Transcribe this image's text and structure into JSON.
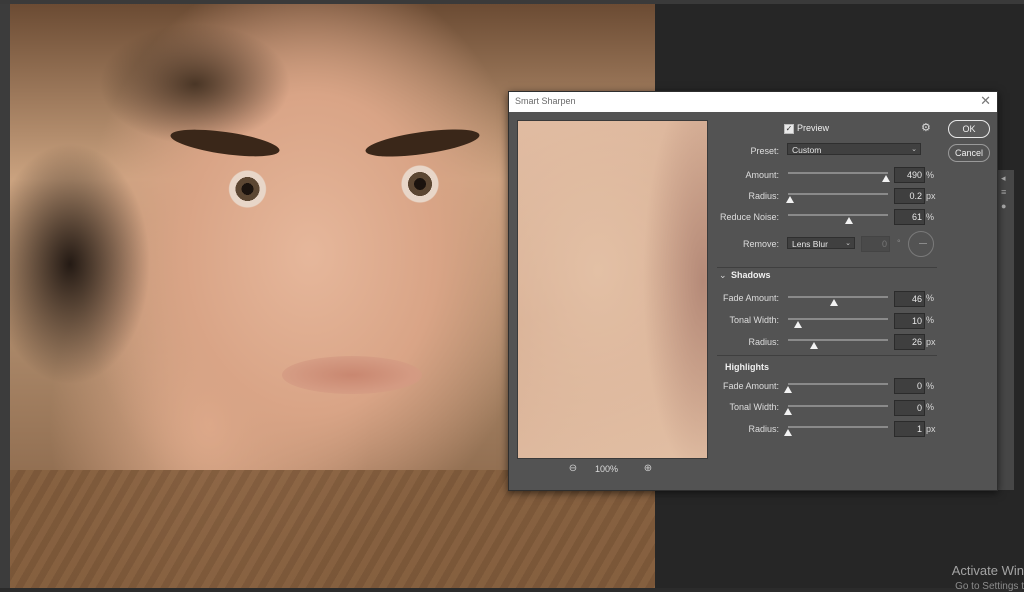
{
  "dialog": {
    "title": "Smart Sharpen",
    "close_icon": "close-icon",
    "preview_label": "Preview",
    "preview_checked": true,
    "gear_icon": "gear-icon",
    "ok_label": "OK",
    "cancel_label": "Cancel",
    "preset_label": "Preset:",
    "preset_value": "Custom",
    "zoom_level": "100%",
    "zoom_out_icon": "zoom-out-icon",
    "zoom_in_icon": "zoom-in-icon"
  },
  "sharpen": {
    "amount": {
      "label": "Amount:",
      "value": "490",
      "unit": "%",
      "level": 0.98
    },
    "radius": {
      "label": "Radius:",
      "value": "0.2",
      "unit": "px",
      "level": 0.02
    },
    "reduce_noise": {
      "label": "Reduce Noise:",
      "value": "61",
      "unit": "%",
      "level": 0.61
    },
    "remove": {
      "label": "Remove:",
      "value": "Lens Blur",
      "angle": "0",
      "angle_unit": "°"
    }
  },
  "shadows": {
    "title": "Shadows",
    "fade_amount": {
      "label": "Fade Amount:",
      "value": "46",
      "unit": "%",
      "level": 0.46
    },
    "tonal_width": {
      "label": "Tonal Width:",
      "value": "10",
      "unit": "%",
      "level": 0.1
    },
    "radius": {
      "label": "Radius:",
      "value": "26",
      "unit": "px",
      "level": 0.26
    }
  },
  "highlights": {
    "title": "Highlights",
    "fade_amount": {
      "label": "Fade Amount:",
      "value": "0",
      "unit": "%",
      "level": 0.0
    },
    "tonal_width": {
      "label": "Tonal Width:",
      "value": "0",
      "unit": "%",
      "level": 0.0
    },
    "radius": {
      "label": "Radius:",
      "value": "1",
      "unit": "px",
      "level": 0.0
    }
  },
  "watermark": {
    "line1": "Activate Win",
    "line2": "Go to Settings t"
  }
}
